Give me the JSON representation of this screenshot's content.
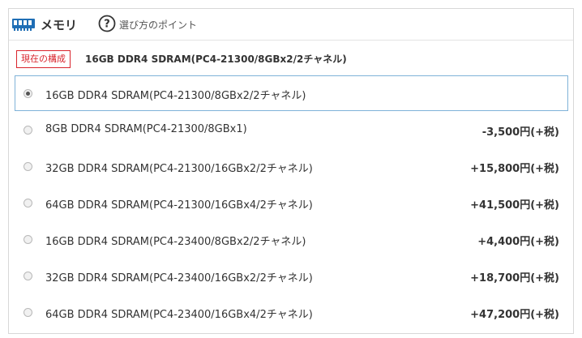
{
  "header": {
    "title": "メモリ",
    "icon": "memory-chip-icon",
    "help_icon": "question-circle-icon",
    "help_link": "選び方のポイント"
  },
  "current": {
    "badge": "現在の構成",
    "value": "16GB DDR4 SDRAM(PC4-21300/8GBx2/2チャネル)"
  },
  "options": [
    {
      "label": "16GB DDR4 SDRAM(PC4-21300/8GBx2/2チャネル)",
      "price": "",
      "selected": true
    },
    {
      "label": "8GB DDR4 SDRAM(PC4-21300/8GBx1)",
      "price": "-3,500円(+税)",
      "selected": false
    },
    {
      "label": "32GB DDR4 SDRAM(PC4-21300/16GBx2/2チャネル)",
      "price": "+15,800円(+税)",
      "selected": false
    },
    {
      "label": "64GB DDR4 SDRAM(PC4-21300/16GBx4/2チャネル)",
      "price": "+41,500円(+税)",
      "selected": false
    },
    {
      "label": "16GB DDR4 SDRAM(PC4-23400/8GBx2/2チャネル)",
      "price": "+4,400円(+税)",
      "selected": false
    },
    {
      "label": "32GB DDR4 SDRAM(PC4-23400/16GBx2/2チャネル)",
      "price": "+18,700円(+税)",
      "selected": false
    },
    {
      "label": "64GB DDR4 SDRAM(PC4-23400/16GBx4/2チャネル)",
      "price": "+47,200円(+税)",
      "selected": false
    }
  ],
  "colors": {
    "accent_red": "#d9242c",
    "selected_border": "#7fb2d8",
    "icon_blue": "#1f6eb5"
  }
}
